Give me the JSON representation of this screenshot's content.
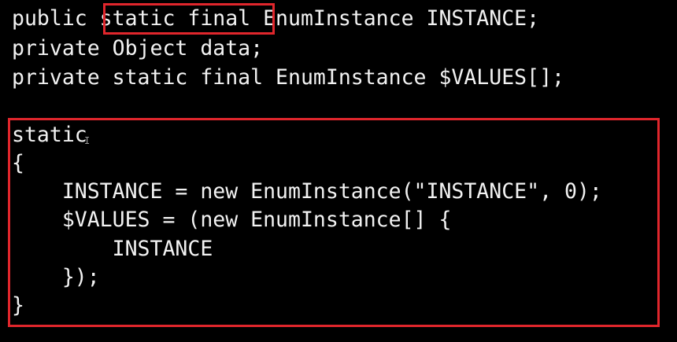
{
  "code": {
    "lines": [
      "public static final EnumInstance INSTANCE;",
      "private Object data;",
      "private static final EnumInstance $VALUES[];",
      "static",
      "{",
      "    INSTANCE = new EnumInstance(\"INSTANCE\", 0);",
      "    $VALUES = (new EnumInstance[] {",
      "        INSTANCE",
      "    });",
      "}"
    ]
  },
  "highlights": {
    "color": "#e0262c"
  },
  "cursor": {
    "glyph": "I"
  }
}
